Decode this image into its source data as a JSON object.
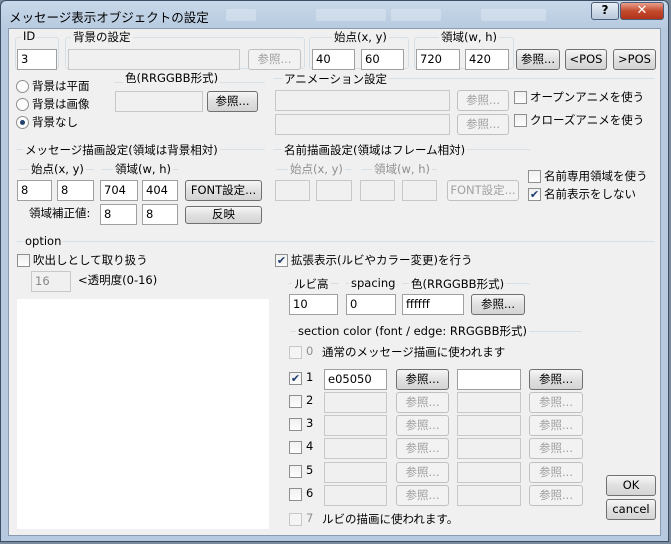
{
  "window": {
    "title": "メッセージ表示オブジェクトの設定",
    "help": "?",
    "close": "✕"
  },
  "top": {
    "id_label": "ID",
    "id_value": "3",
    "bg_label": "背景の設定",
    "bg_value": "",
    "bg_ref": "参照...",
    "start_label": "始点(x, y)",
    "start_x": "40",
    "start_y": "60",
    "area_label": "領域(w, h)",
    "area_w": "720",
    "area_h": "420",
    "area_ref": "参照...",
    "pos_prev": "<POS",
    "pos_next": ">POS"
  },
  "bg_mode": {
    "options": [
      "背景は平面",
      "背景は画像",
      "背景なし"
    ],
    "selected": 2,
    "color_label": "色(RRGGBB形式)",
    "color_value": "",
    "color_ref": "参照..."
  },
  "animation": {
    "label": "アニメーション設定",
    "open_value": "",
    "open_ref": "参照...",
    "close_value": "",
    "close_ref": "参照...",
    "open_check": "オープンアニメを使う",
    "close_check": "クローズアニメを使う"
  },
  "msg_area": {
    "label": "メッセージ描画設定(領域は背景相対)",
    "start_label": "始点(x, y)",
    "area_label": "領域(w, h)",
    "x": "8",
    "y": "8",
    "w": "704",
    "h": "404",
    "font_button": "FONT設定...",
    "adjust_label": "領域補正値:",
    "adj_x": "8",
    "adj_y": "8",
    "reflect_button": "反映"
  },
  "name_area": {
    "label": "名前描画設定(領域はフレーム相対)",
    "start_label": "始点(x, y)",
    "area_label": "領域(w, h)",
    "font_button": "FONT設定...",
    "use_area": "名前専用領域を使う",
    "use_area_checked": false,
    "hide_name": "名前表示をしない",
    "hide_name_checked": true
  },
  "option": {
    "label": "option",
    "balloon": "吹出しとして取り扱う",
    "balloon_checked": false,
    "alpha_value": "16",
    "alpha_label": "<透明度(0-16)"
  },
  "extended": {
    "check": "拡張表示(ルビやカラー変更)を行う",
    "checked": true,
    "ruby_label": "ルビ高",
    "ruby_value": "10",
    "spacing_label": "spacing",
    "spacing_value": "0",
    "color_label": "色(RRGGBB形式)",
    "color_value": "ffffff",
    "color_ref": "参照..."
  },
  "section": {
    "label": "section color (font / edge: RRGGBB形式)",
    "row0_num": "0",
    "row0_text": "通常のメッセージ描画に使われます",
    "row7_num": "7",
    "row7_text": "ルビの描画に使われます。",
    "rows": [
      {
        "num": "1",
        "checked": true,
        "font": "e05050",
        "edge": "",
        "ref1": "参照...",
        "ref2": "参照..."
      },
      {
        "num": "2",
        "checked": false,
        "font": "",
        "edge": "",
        "ref1": "参照...",
        "ref2": "参照..."
      },
      {
        "num": "3",
        "checked": false,
        "font": "",
        "edge": "",
        "ref1": "参照...",
        "ref2": "参照..."
      },
      {
        "num": "4",
        "checked": false,
        "font": "",
        "edge": "",
        "ref1": "参照...",
        "ref2": "参照..."
      },
      {
        "num": "5",
        "checked": false,
        "font": "",
        "edge": "",
        "ref1": "参照...",
        "ref2": "参照..."
      },
      {
        "num": "6",
        "checked": false,
        "font": "",
        "edge": "",
        "ref1": "参照...",
        "ref2": "参照..."
      }
    ]
  },
  "buttons": {
    "ok": "OK",
    "cancel": "cancel"
  }
}
